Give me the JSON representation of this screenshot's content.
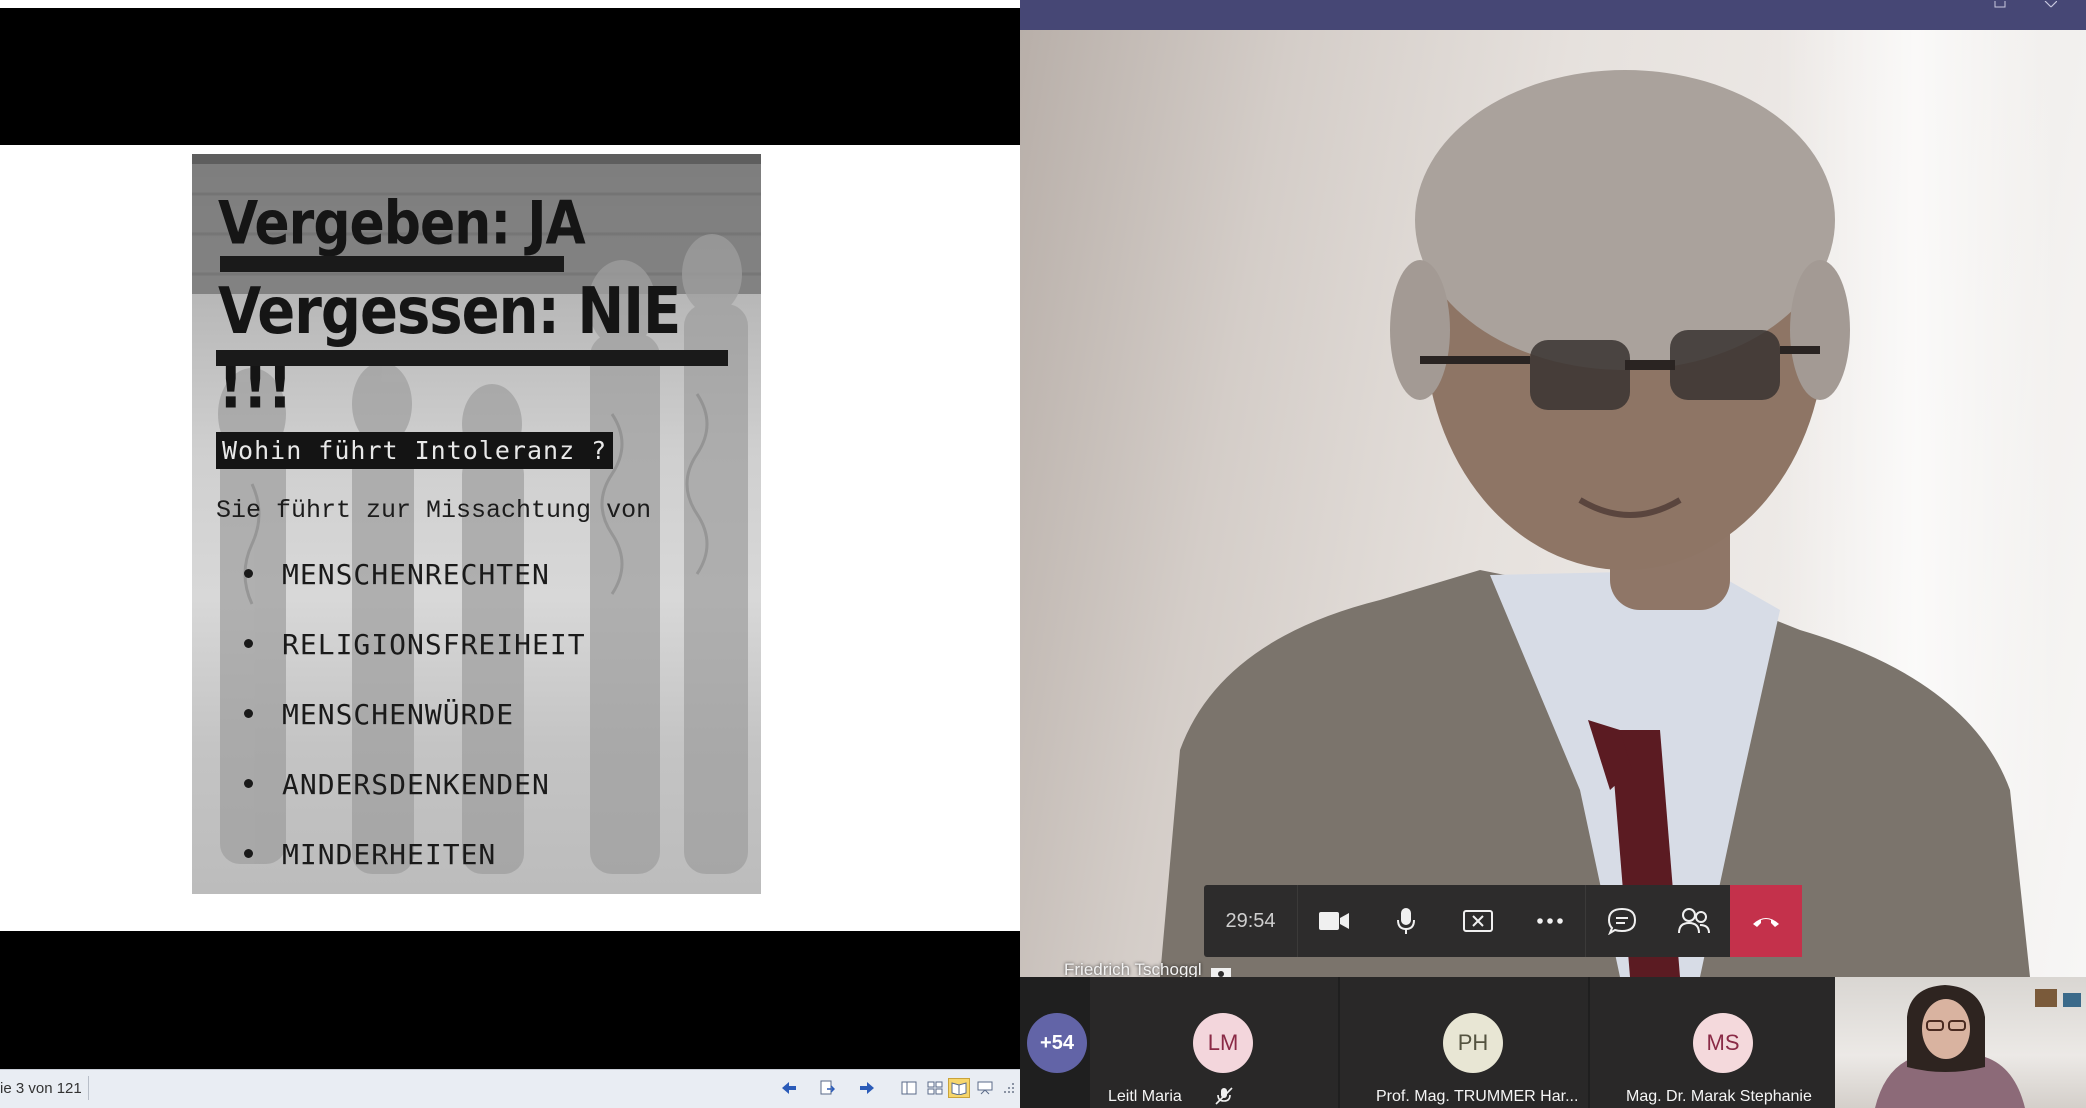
{
  "document": {
    "poster": {
      "line1": "Vergeben:  JA",
      "line2": "Vergessen:  NIE !!!",
      "question": "Wohin führt Intoleranz ?",
      "lead": "Sie führt zur Missachtung von",
      "items": [
        "MENSCHENRECHTEN",
        "RELIGIONSFREIHEIT",
        "MENSCHENWÜRDE",
        "ANDERSDENKENDEN",
        "MINDERHEITEN"
      ]
    },
    "statusbar": {
      "page_text": "ie 3 von 121"
    }
  },
  "meeting": {
    "timer": "29:54",
    "speaker_name": "Friedrich Tschoggl",
    "overflow_count": "+54",
    "participants": [
      {
        "initials": "LM",
        "name": "Leitl Maria",
        "avatar_color": "#f3d6dc",
        "muted": true
      },
      {
        "initials": "PH",
        "name": "Prof. Mag. TRUMMER Har...",
        "avatar_color": "#e8e6d4",
        "muted": false
      },
      {
        "initials": "MS",
        "name": "Mag. Dr. Marak Stephanie",
        "avatar_color": "#f4d9dc",
        "muted": false
      }
    ],
    "colors": {
      "titlebar": "#464775",
      "hangup": "#c4314b",
      "overflow_badge": "#6264a7"
    }
  }
}
